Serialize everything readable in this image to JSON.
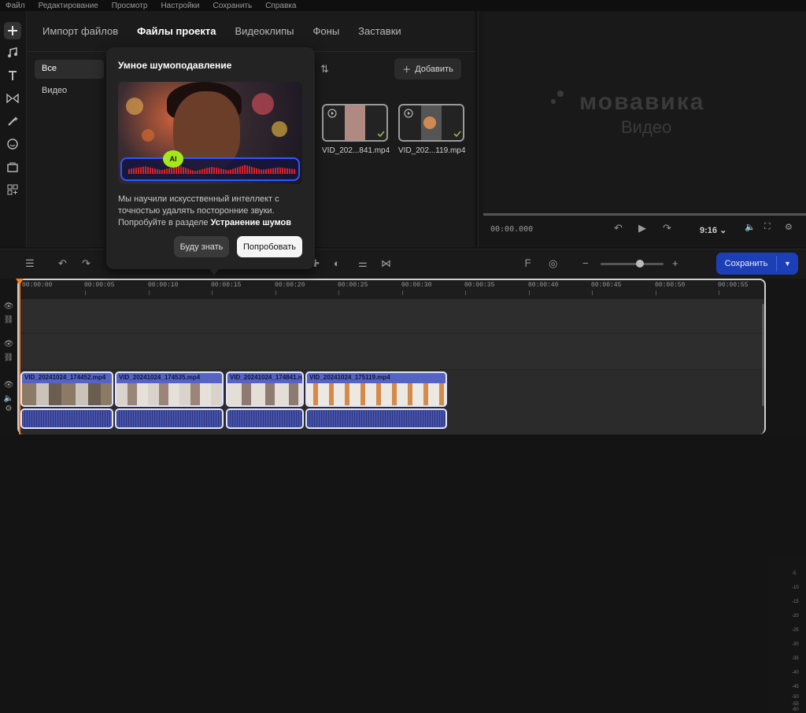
{
  "menu": [
    "Файл",
    "Редактирование",
    "Просмотр",
    "Настройки",
    "Сохранить",
    "Справка"
  ],
  "tabs": [
    "Импорт файлов",
    "Файлы проекта",
    "Видеоклипы",
    "Фоны",
    "Заставки"
  ],
  "active_tab": "Файлы проекта",
  "categories": [
    "Все",
    "Видео"
  ],
  "add_button": "Добавить",
  "files": [
    "VID_202...841.mp4",
    "VID_202...119.mp4"
  ],
  "preview": {
    "logo": "мовавика",
    "logo_sub": "Видео",
    "time": "00:00.000",
    "aspect": "9:16"
  },
  "save_button": "Сохранить",
  "ruler_labels": [
    "00:00:00",
    "00:00:05",
    "00:00:10",
    "00:00:15",
    "00:00:20",
    "00:00:25",
    "00:00:30",
    "00:00:35",
    "00:00:40",
    "00:00:45",
    "00:00:50",
    "00:00:55"
  ],
  "clips": [
    "VID_20241024_174452.mp4",
    "VID_20241024_174535.mp4",
    "VID_20241024_174841.n",
    "VID_20241024_175119.mp4"
  ],
  "meter_ticks": [
    "-5",
    "-10",
    "-15",
    "-20",
    "-25",
    "-30",
    "-35",
    "-40",
    "-45",
    "-50",
    "-55",
    "-60"
  ],
  "popup": {
    "title": "Умное шумоподавление",
    "ai_badge": "AI",
    "text_1": "Мы научили искусственный интеллект с точностью удалять посторонние звуки. Попробуйте в разделе ",
    "text_bold": "Устранение шумов",
    "later_button": "Буду знать",
    "try_button": "Попробовать"
  },
  "colors": {
    "accent": "#1c3fb8",
    "playhead": "#ff7a1a",
    "clip": "#5563c4",
    "ai": "#a4e81a"
  }
}
